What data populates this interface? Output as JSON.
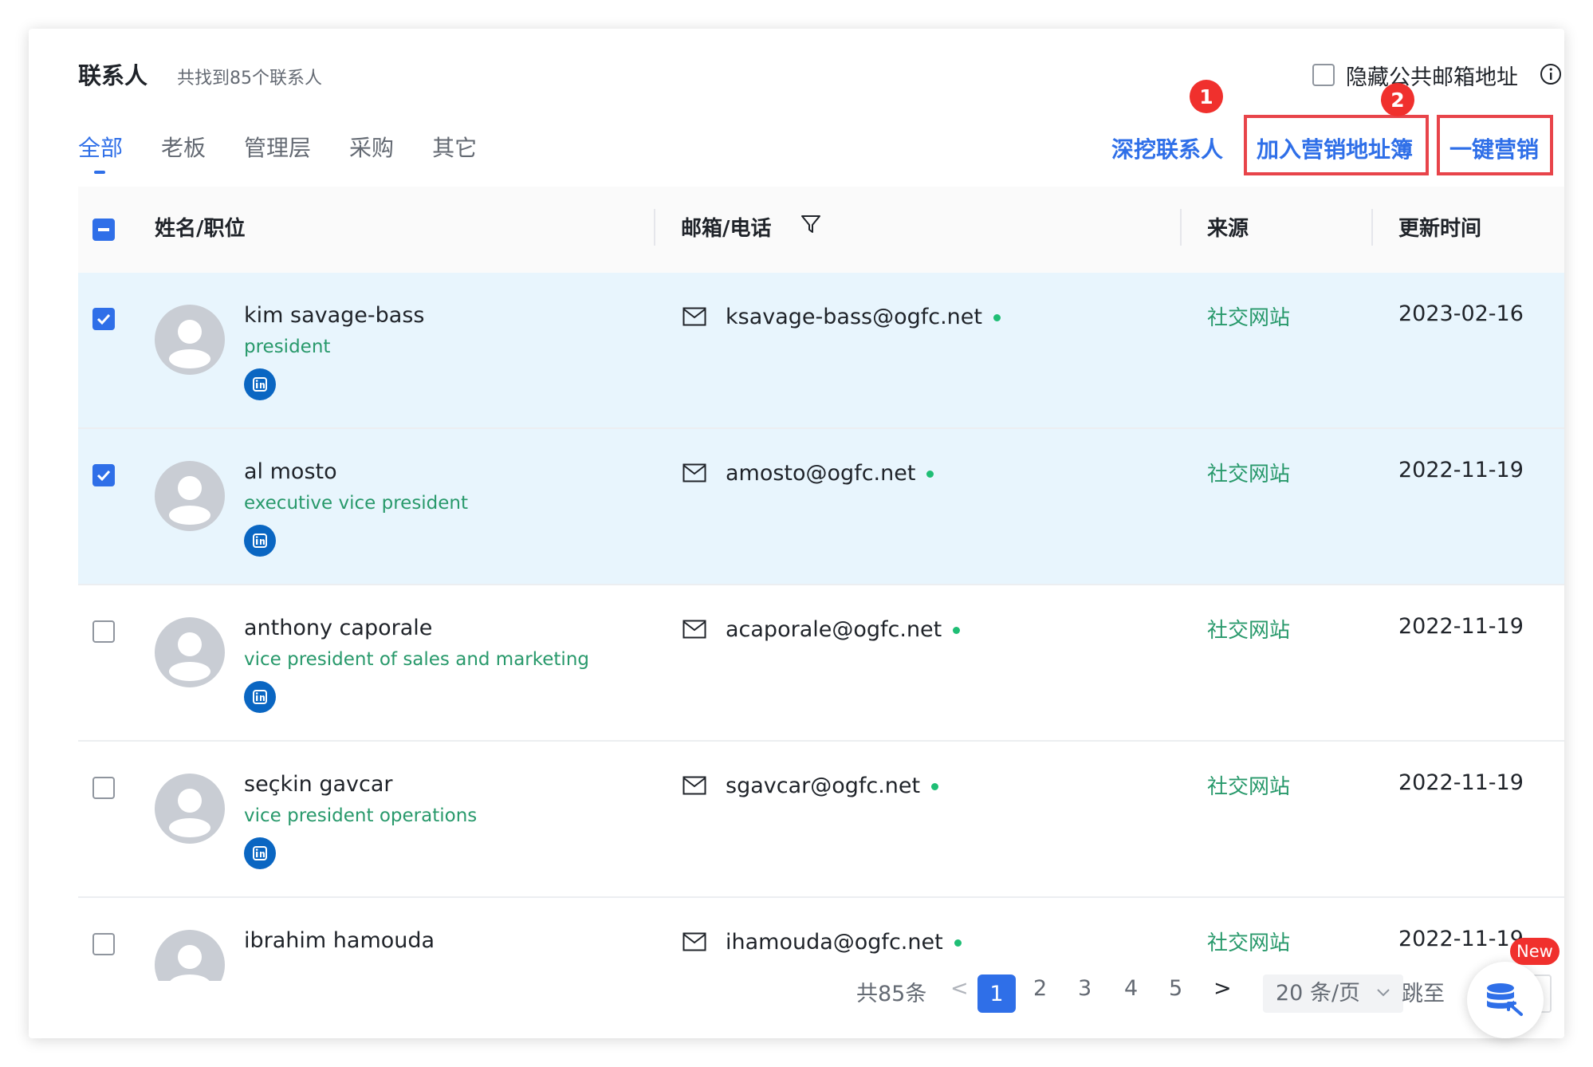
{
  "header": {
    "title": "联系人",
    "subtitle": "共找到85个联系人",
    "hide_public_label": "隐藏公共邮箱地址"
  },
  "tabs": [
    {
      "label": "全部",
      "active": true
    },
    {
      "label": "老板",
      "active": false
    },
    {
      "label": "管理层",
      "active": false
    },
    {
      "label": "采购",
      "active": false
    },
    {
      "label": "其它",
      "active": false
    }
  ],
  "actions": {
    "dig": "深挖联系人",
    "add_to_book": "加入营销地址簿",
    "one_click": "一键营销",
    "badge_1": "1",
    "badge_2": "2"
  },
  "table": {
    "columns": {
      "name": "姓名/职位",
      "contact": "邮箱/电话",
      "source": "来源",
      "updated": "更新时间"
    },
    "rows": [
      {
        "name": "kim savage-bass",
        "position": "president",
        "email": "ksavage-bass@ogfc.net",
        "source": "社交网站",
        "date": "2023-02-16",
        "selected": true
      },
      {
        "name": "al mosto",
        "position": "executive vice president",
        "email": "amosto@ogfc.net",
        "source": "社交网站",
        "date": "2022-11-19",
        "selected": true
      },
      {
        "name": "anthony caporale",
        "position": "vice president of sales and marketing",
        "email": "acaporale@ogfc.net",
        "source": "社交网站",
        "date": "2022-11-19",
        "selected": false
      },
      {
        "name": "seçkin gavcar",
        "position": "vice president operations",
        "email": "sgavcar@ogfc.net",
        "source": "社交网站",
        "date": "2022-11-19",
        "selected": false
      },
      {
        "name": "ibrahim hamouda",
        "position": "",
        "email": "ihamouda@ogfc.net",
        "source": "社交网站",
        "date": "2022-11-19",
        "selected": false
      }
    ]
  },
  "pagination": {
    "total": "共85条",
    "prev": "<",
    "next": ">",
    "pages": [
      "1",
      "2",
      "3",
      "4",
      "5"
    ],
    "current": "1",
    "page_size": "20 条/页",
    "jump_label": "跳至"
  },
  "float": {
    "new_badge": "New"
  },
  "colors": {
    "accent": "#2f6fe8",
    "source_green": "#28996b",
    "selected_row": "#e8f5fd",
    "highlight_red": "#e8444a"
  }
}
